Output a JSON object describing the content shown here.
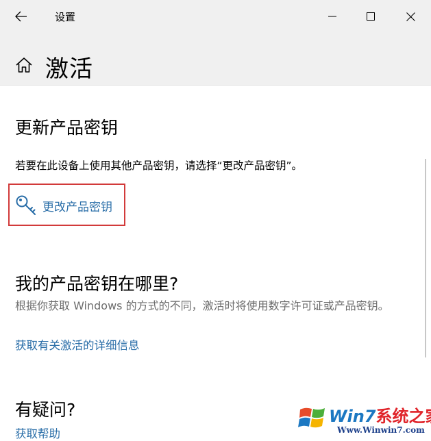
{
  "window": {
    "app_title": "设置"
  },
  "header": {
    "title": "激活"
  },
  "icons": {
    "back": "back-arrow-icon",
    "minimize": "minimize-icon",
    "maximize": "maximize-icon",
    "close": "close-icon",
    "home": "home-icon",
    "key": "key-icon"
  },
  "update_key": {
    "heading": "更新产品密钥",
    "description": "若要在此设备上使用其他产品密钥，请选择“更改产品密钥”。",
    "change_key_label": "更改产品密钥"
  },
  "where_key": {
    "heading": "我的产品密钥在哪里?",
    "description": "根据你获取 Windows 的方式的不同，激活时将使用数字许可证或产品密钥。",
    "link": "获取有关激活的详细信息"
  },
  "questions": {
    "heading": "有疑问?",
    "link": "获取帮助"
  },
  "watermark": {
    "brand_part1": "Win7",
    "brand_part2": "系统之家",
    "url": "Www.Winwin7.com"
  },
  "colors": {
    "accent_link": "#2a6ea8",
    "highlight_border": "#d23a3a",
    "chrome_bg": "#f0f0f0"
  }
}
